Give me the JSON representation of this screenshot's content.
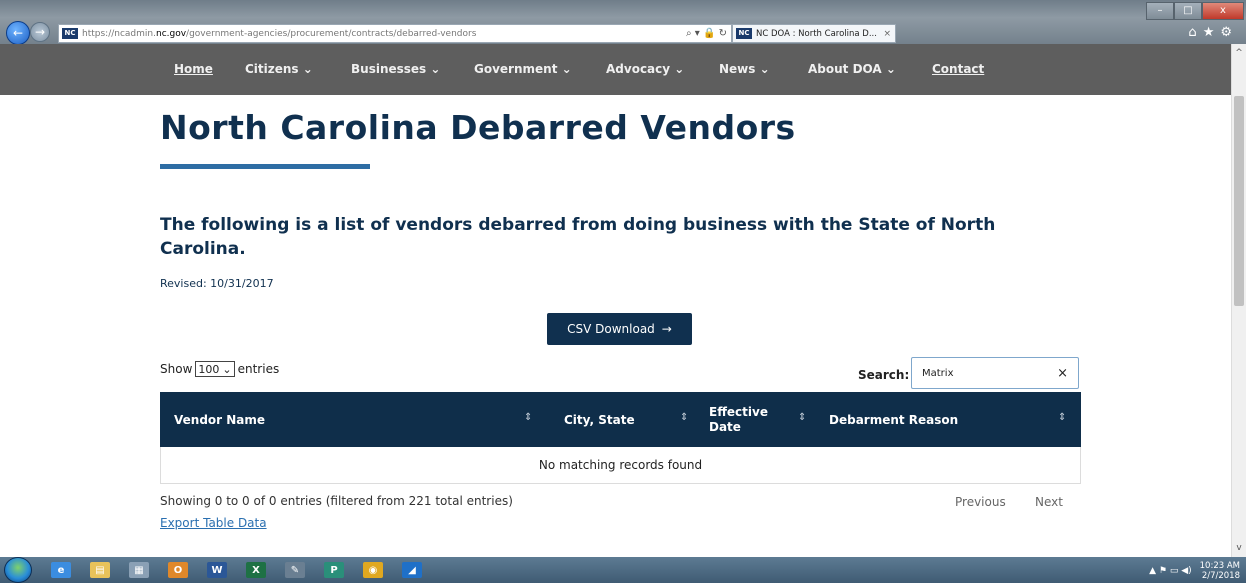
{
  "browser": {
    "url_prefix": "https://ncadmin.",
    "url_domain": "nc.gov",
    "url_path": "/government-agencies/procurement/contracts/debarred-vendors",
    "favicon_text": "NC",
    "search_glyph": "⌕ ▾ 🔒 ↻",
    "tab_title": "NC DOA : North Carolina D...",
    "tab_close": "×",
    "min": "–",
    "max": "□",
    "close": "x"
  },
  "nav": {
    "items": [
      {
        "label": "Home"
      },
      {
        "label": "Citizens ⌄"
      },
      {
        "label": "Businesses ⌄"
      },
      {
        "label": "Government ⌄"
      },
      {
        "label": "Advocacy ⌄"
      },
      {
        "label": "News ⌄"
      },
      {
        "label": "About DOA ⌄"
      },
      {
        "label": "Contact"
      }
    ]
  },
  "page": {
    "title": "North Carolina Debarred Vendors",
    "intro": "The following is a list of vendors debarred from doing business with the State of North Carolina.",
    "revised_label": "Revised:",
    "revised_date": "10/31/2017",
    "csv_label": "CSV Download",
    "csv_arrow": "→"
  },
  "table": {
    "show_label": "Show",
    "entries_value": "100",
    "entries_label": "entries",
    "search_label": "Search:",
    "search_value": "Matrix",
    "search_clear": "×",
    "columns": [
      {
        "label": "Vendor Name"
      },
      {
        "label": "City, State"
      },
      {
        "label": "Effective Date"
      },
      {
        "label": "Debarment Reason"
      }
    ],
    "sort_glyph": "⇕",
    "empty_message": "No matching records found",
    "info": "Showing 0 to 0 of 0 entries (filtered from 221 total entries)",
    "previous": "Previous",
    "next": "Next",
    "export": "Export Table Data"
  },
  "taskbar": {
    "items": [
      {
        "name": "ie",
        "glyph": "e",
        "color": "#3b8de0"
      },
      {
        "name": "explorer",
        "glyph": "▤",
        "color": "#e8c25a"
      },
      {
        "name": "app",
        "glyph": "▦",
        "color": "#8aa0b5"
      },
      {
        "name": "outlook",
        "glyph": "O",
        "color": "#e0882a"
      },
      {
        "name": "word",
        "glyph": "W",
        "color": "#2b5797"
      },
      {
        "name": "excel",
        "glyph": "X",
        "color": "#1e7145"
      },
      {
        "name": "tool",
        "glyph": "✎",
        "color": "#6a7f92"
      },
      {
        "name": "project",
        "glyph": "P",
        "color": "#2a8f7a"
      },
      {
        "name": "chrome",
        "glyph": "◉",
        "color": "#e0a820"
      },
      {
        "name": "app2",
        "glyph": "◢",
        "color": "#1f70c8"
      }
    ],
    "tray_icons": "▲ ⚑ ▭ ◀)",
    "time": "10:23 AM",
    "date": "2/7/2018"
  },
  "colors": {
    "navy": "#10304f",
    "accent": "#2e6da4",
    "nav_bg": "#5e5e5e"
  }
}
